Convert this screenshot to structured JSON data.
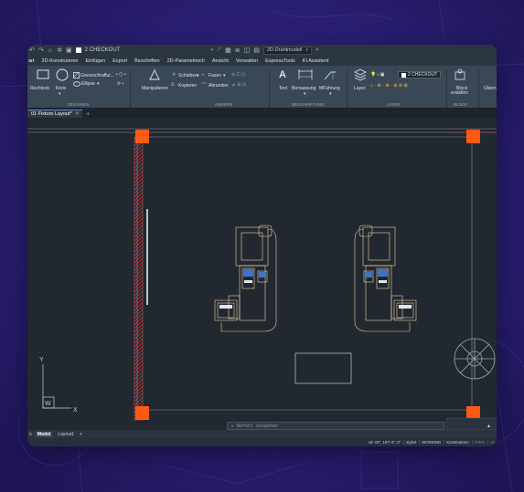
{
  "colors": {
    "background": "#241a66",
    "grip": "#ff5a14",
    "furniture": "#f0d2a4",
    "wall_hatch": "#d24646"
  },
  "qat": {
    "workspace": "2 CHECKOUT",
    "title": "2D-Drahtmodell"
  },
  "menu": [
    "art",
    "2D-Konstruieren",
    "Einfügen",
    "Export",
    "Beschriften",
    "2D-Parametrisch",
    "Ansicht",
    "Verwalten",
    "ExpressTools",
    "KI Assistent"
  ],
  "ribbon": {
    "draw": {
      "rechteck": "Rechteck",
      "kreis": "Kreis",
      "grenz": "Grenzschraffur...",
      "ellipse": "Ellipse",
      "section": "ZEICHNEN"
    },
    "modify": {
      "manipulieren": "Manipulieren",
      "schieben": "Schieben",
      "kopieren": "Kopieren",
      "fasen": "Fasen",
      "abrunden": "Abrunden",
      "section": "ÄNDERN"
    },
    "annotate": {
      "text": "Text",
      "bemassung": "Bemassung",
      "mfuehrung": "MFührung",
      "section": "BESCHRIFTUNG"
    },
    "layers": {
      "layer": "Layer",
      "current": "2 CHECKOUT",
      "section": "LAYER"
    },
    "block": {
      "label1": "Block",
      "label2": "erstellen",
      "section": "BLOCK"
    },
    "extra": "Übern"
  },
  "doc_tab": {
    "label": "01 Fixture Layout*",
    "close": "×",
    "add": "+"
  },
  "ucs": {
    "x": "X",
    "y": "Y",
    "w": "W"
  },
  "command_line": "Befehl eingeben",
  "layout_tabs": [
    "Model",
    "Layout1"
  ],
  "layout_add": "+",
  "status": {
    "coords": "44'-10\", 107'-4\", 0\"",
    "style": "style2",
    "working": "WORKING",
    "mode": "Konstruieren",
    "fang": "FANG",
    "extra": "GI"
  }
}
